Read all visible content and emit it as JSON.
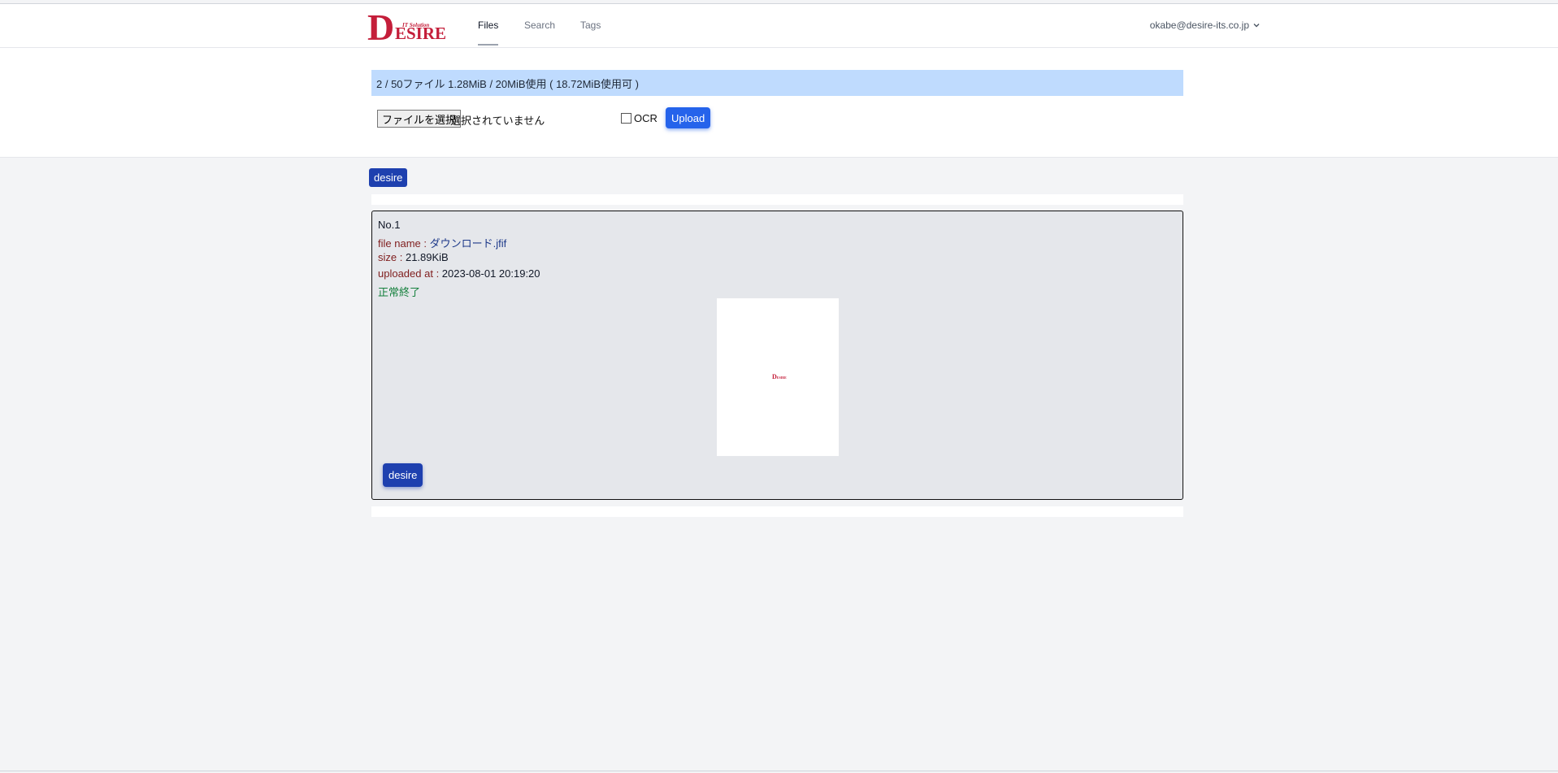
{
  "header": {
    "logo_text": "DESIRE",
    "logo_subtext": "IT Solution",
    "tabs": [
      {
        "label": "Files",
        "active": true
      },
      {
        "label": "Search",
        "active": false
      },
      {
        "label": "Tags",
        "active": false
      }
    ],
    "user_email": "okabe@desire-its.co.jp"
  },
  "upload": {
    "usage_text": "2 / 50ファイル 1.28MiB / 20MiB使用 ( 18.72MiB使用可 )",
    "file_button_label": "ファイルを選択",
    "file_status": "選択されていません",
    "ocr_label": "OCR",
    "ocr_checked": false,
    "upload_button_label": "Upload"
  },
  "filter_tag": "desire",
  "files": [
    {
      "no": "No.1",
      "file_name_label": "file name : ",
      "file_name": "ダウンロード.jfif",
      "size_label": "size : ",
      "size": "21.89KiB",
      "uploaded_label": "uploaded at : ",
      "uploaded_at": "2023-08-01 20:19:20",
      "status": "正常終了",
      "tag": "desire"
    }
  ],
  "colors": {
    "brand_red": "#c41e3a",
    "primary_blue": "#2563eb",
    "tag_blue": "#1e40af",
    "usage_bg": "#bfdbfe",
    "success_green": "#15803d"
  }
}
